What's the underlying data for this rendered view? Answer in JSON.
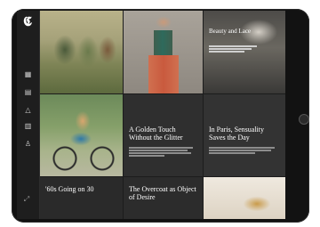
{
  "sidebar": {
    "logo": "𝕮",
    "items": [
      {
        "icon": "front-page-icon",
        "glyph": "▦",
        "label": ""
      },
      {
        "icon": "saved-icon",
        "glyph": "▤",
        "label": ""
      },
      {
        "icon": "sections-icon",
        "glyph": "△",
        "label": ""
      },
      {
        "icon": "photos-icon",
        "glyph": "▥",
        "label": ""
      },
      {
        "icon": "profile-icon",
        "glyph": "♙",
        "label": ""
      }
    ],
    "expand_glyph": "⤢"
  },
  "tiles": {
    "golden": {
      "headline": "A Golden Touch Without the Glitter"
    },
    "paris": {
      "headline": "In Paris, Sensuality Saves the Day"
    },
    "sixties": {
      "headline": "'60s Going on 30"
    },
    "overcoat": {
      "headline": "The Overcoat as Object of Desire"
    },
    "paris_photo": {
      "headline": "Beauty and Lace"
    }
  },
  "colors": {
    "bezel": "#121212",
    "screen": "#1c1c1c",
    "text_tile": "#2f2f2f"
  }
}
